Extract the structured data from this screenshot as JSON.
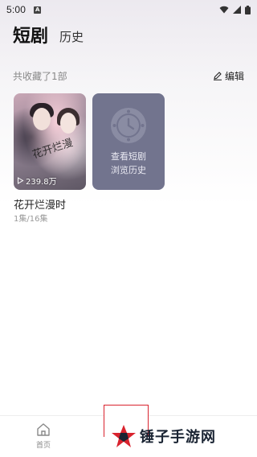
{
  "status_bar": {
    "time": "5:00",
    "notification_badge": "A",
    "icons": [
      "wifi-icon",
      "signal-icon",
      "battery-icon"
    ]
  },
  "tabs": [
    {
      "label": "短剧",
      "active": true
    },
    {
      "label": "历史",
      "active": false
    }
  ],
  "collection": {
    "count_text": "共收藏了1部",
    "edit_label": "编辑"
  },
  "dramas": [
    {
      "title": "花开烂漫时",
      "episodes": "1集/16集",
      "views": "239.8万",
      "poster_title": "花开烂漫"
    }
  ],
  "history_card": {
    "line1": "查看短剧",
    "line2": "浏览历史"
  },
  "bottom_nav": {
    "home_label": "首页"
  },
  "watermark": {
    "text": "锤子手游网"
  },
  "colors": {
    "history_card_bg": "#72748e",
    "watermark_red": "#d9232e",
    "watermark_dark": "#1a2433"
  }
}
